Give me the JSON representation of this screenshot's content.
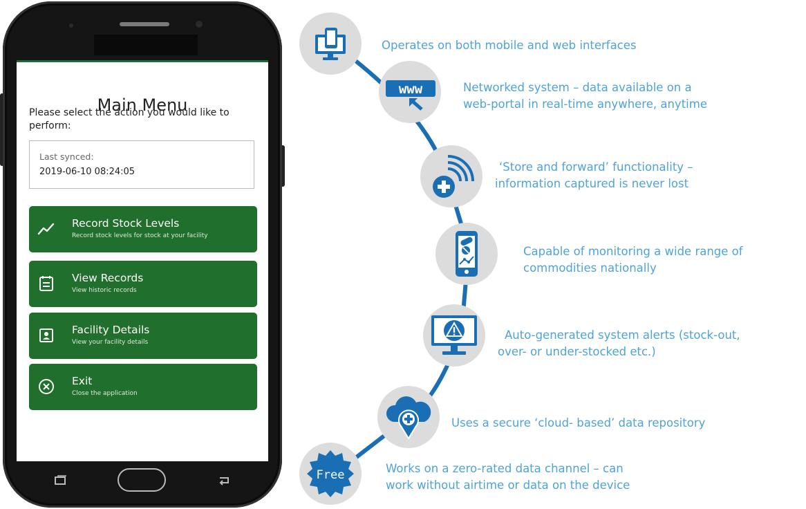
{
  "phone": {
    "screen": {
      "title": "Main Menu",
      "prompt": "Please select the action you would like to perform:",
      "sync": {
        "label": "Last synced:",
        "value": "2019-06-10 08:24:05"
      },
      "menu": [
        {
          "title": "Record Stock Levels",
          "subtitle": "Record stock levels for stock at your facility",
          "icon": "chart-line-icon"
        },
        {
          "title": "View Records",
          "subtitle": "View historic records",
          "icon": "calendar-list-icon"
        },
        {
          "title": "Facility Details",
          "subtitle": "View your facility details",
          "icon": "id-card-icon"
        },
        {
          "title": "Exit",
          "subtitle": "Close the application",
          "icon": "close-circle-icon"
        }
      ],
      "accent_color": "#216f2c"
    },
    "nav": [
      "recent-apps-icon",
      "home-button",
      "back-icon"
    ]
  },
  "features": [
    {
      "text": [
        "Operates on both mobile and web interfaces"
      ],
      "icon": "mobile-desktop-icon"
    },
    {
      "text": [
        "Networked system – data available on a",
        "web-portal in real-time anywhere, anytime"
      ],
      "icon": "www-cursor-icon"
    },
    {
      "text": [
        "‘Store and forward’ functionality –",
        "information captured is never lost"
      ],
      "icon": "signal-medical-icon"
    },
    {
      "text": [
        "Capable of monitoring a wide range of",
        "commodities nationally"
      ],
      "icon": "phone-pills-icon"
    },
    {
      "text": [
        "Auto-generated system alerts (stock-out,",
        "over- or under-stocked etc.)"
      ],
      "icon": "monitor-alert-icon"
    },
    {
      "text": [
        "Uses a secure ‘cloud- based’ data repository"
      ],
      "icon": "cloud-medical-icon"
    },
    {
      "text": [
        "Works on a zero-rated data channel – can",
        "work without airtime or data on the device"
      ],
      "icon": "free-badge-icon",
      "badge": "Free"
    }
  ],
  "colors": {
    "feature_blue": "#1a6fb4",
    "feature_text": "#4ea3d8",
    "circle_bg": "#dcdcdc"
  }
}
